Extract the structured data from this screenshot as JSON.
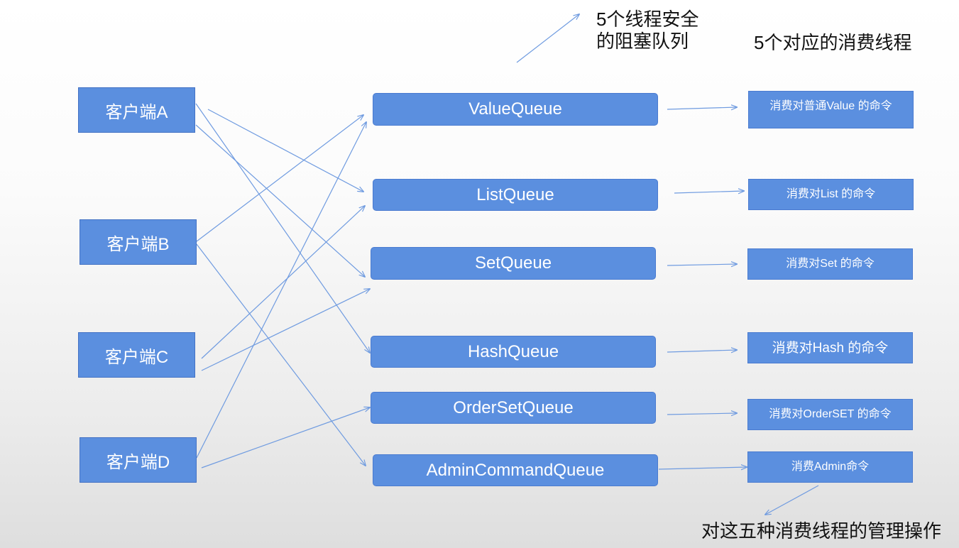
{
  "notes": {
    "queues_note": "5个线程安全\n的阻塞队列",
    "consumers_note": "5个对应的消费线程",
    "admin_note": "对这五种消费线程的管理操作"
  },
  "clients": [
    "客户端A",
    "客户端B",
    "客户端C",
    "客户端D"
  ],
  "queues": [
    "ValueQueue",
    "ListQueue",
    "SetQueue",
    "HashQueue",
    "OrderSetQueue",
    "AdminCommandQueue"
  ],
  "consumers": [
    "消费对普通Value 的命令",
    "消费对List 的命令",
    "消费对Set 的命令",
    "消费对Hash 的命令",
    "消费对OrderSET 的命令",
    "消费Admin命令"
  ],
  "colors": {
    "box_fill": "#5b8fdf",
    "arrow": "#6f9be0",
    "text_dark": "#111111"
  }
}
